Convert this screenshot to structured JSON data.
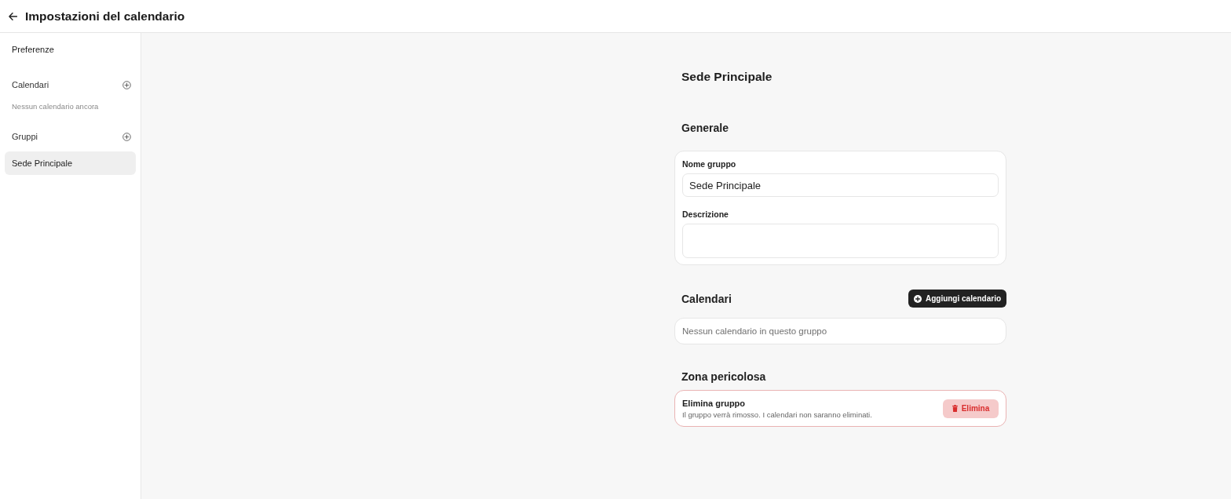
{
  "header": {
    "title": "Impostazioni del calendario"
  },
  "sidebar": {
    "preferences": {
      "label": "Preferenze",
      "selected": false
    },
    "sections": [
      {
        "title": "Calendari",
        "empty_text": "Nessun calendario ancora"
      },
      {
        "title": "Gruppi",
        "items": [
          {
            "label": "Sede Principale",
            "selected": true
          }
        ]
      }
    ]
  },
  "main": {
    "title": "Sede Principale",
    "general": {
      "heading": "Generale",
      "fields": [
        {
          "kind": "input",
          "label": "Nome gruppo",
          "value": "Sede Principale"
        },
        {
          "kind": "textarea",
          "label": "Descrizione"
        }
      ]
    },
    "calendars": {
      "heading": "Calendari",
      "add_button": "Aggiungi calendario",
      "empty_text": "Nessun calendario in questo gruppo"
    },
    "danger_zone": {
      "heading": "Zona pericolosa",
      "title": "Elimina gruppo",
      "description": "Il gruppo verrà rimosso. I calendari non saranno eliminati.",
      "button": "Elimina"
    }
  }
}
